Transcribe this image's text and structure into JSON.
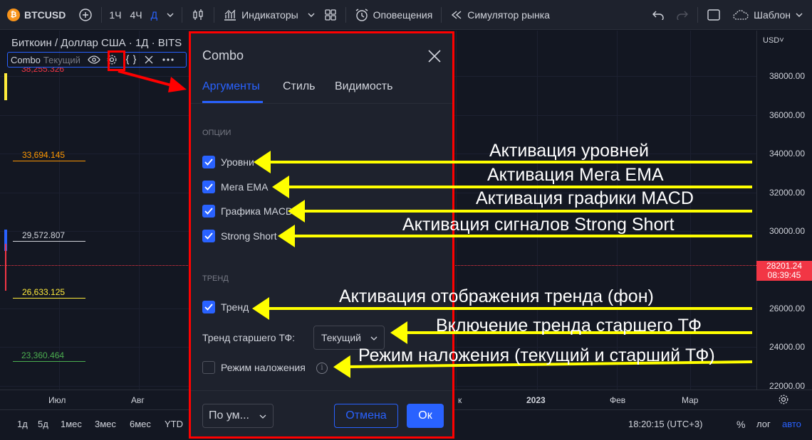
{
  "toolbar": {
    "symbol": "BTCUSD",
    "btc_glyph": "₿",
    "timeframes": [
      "1Ч",
      "4Ч",
      "Д"
    ],
    "indicators_label": "Индикаторы",
    "alerts_label": "Оповещения",
    "replay_label": "Симулятор рынка",
    "template_label": "Шаблон"
  },
  "chart": {
    "title": "Биткоин / Доллар США · 1Д · BITS",
    "indicator_name": "Combo",
    "indicator_tf": "Текущий",
    "levels": [
      {
        "value": "38,255.326",
        "color": "#f23645"
      },
      {
        "value": "33,694.145",
        "color": "#ff9800"
      },
      {
        "value": "29,572.807",
        "color": "#d1d4dc"
      },
      {
        "value": "26,633.125",
        "color": "#ffeb3b"
      },
      {
        "value": "23,360.464",
        "color": "#4caf50"
      }
    ],
    "currency": "USD",
    "price_ticks": [
      "38000.00",
      "36000.00",
      "34000.00",
      "32000.00",
      "30000.00",
      "26000.00",
      "24000.00",
      "22000.00"
    ],
    "current_price": "28201.24",
    "countdown": "08:39:45",
    "time_labels": [
      "Июл",
      "Авг",
      "к",
      "2023",
      "Фев",
      "Мар"
    ]
  },
  "bottom": {
    "ranges": [
      "1д",
      "5д",
      "1мес",
      "3мес",
      "6мес",
      "YTD"
    ],
    "clock": "18:20:15 (UTC+3)",
    "percent": "%",
    "log": "лог",
    "auto": "авто"
  },
  "dialog": {
    "title": "Combo",
    "tabs": [
      "Аргументы",
      "Стиль",
      "Видимость"
    ],
    "section_options": "ОПЦИИ",
    "options": [
      {
        "label": "Уровни",
        "checked": true
      },
      {
        "label": "Мега EMA",
        "checked": true
      },
      {
        "label": "Графика MACD",
        "checked": true
      },
      {
        "label": "Strong Short",
        "checked": true
      }
    ],
    "section_trend": "ТРЕНД",
    "trend": {
      "label": "Тренд",
      "checked": true
    },
    "htf_label": "Тренд старшего ТФ:",
    "htf_value": "Текущий",
    "overlay": {
      "label": "Режим наложения",
      "checked": false
    },
    "defaults_label": "По ум...",
    "cancel_label": "Отмена",
    "ok_label": "Ок"
  },
  "annotations": [
    "Активация уровней",
    "Активация Мега EMA",
    "Активация графики MACD",
    "Активация сигналов Strong Short",
    "Активация отображения тренда (фон)",
    "Включение тренда старшего ТФ",
    "Режим наложения (текущий и старший ТФ)"
  ],
  "colors": {
    "background": "#131722",
    "panel": "#1e222d",
    "accent": "#2962ff",
    "annotation_arrow": "#ffff00",
    "highlight": "#ff0000",
    "price_tag": "#f23645"
  }
}
